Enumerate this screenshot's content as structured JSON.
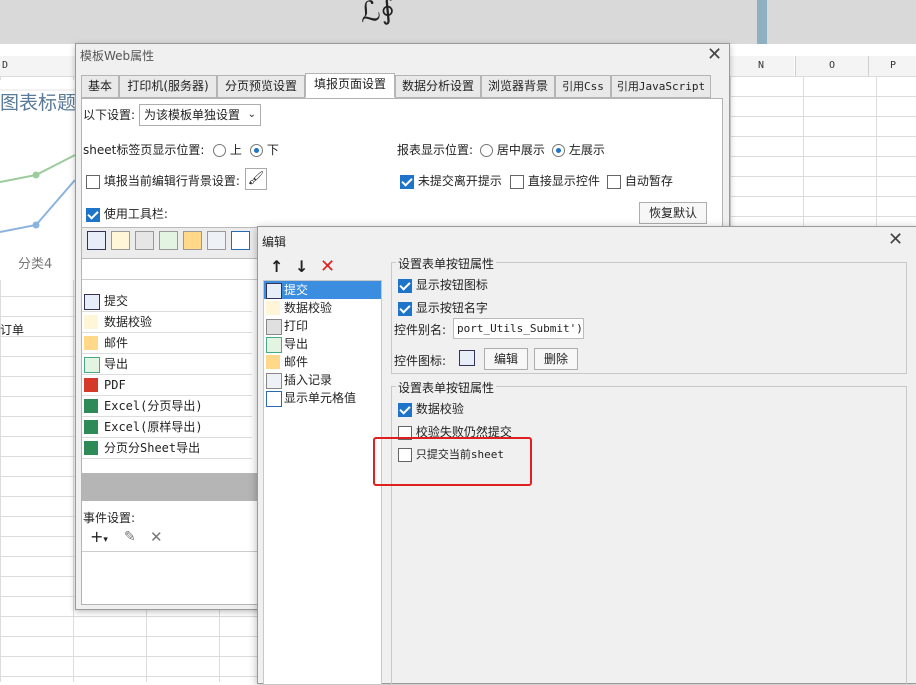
{
  "background": {
    "columns": [
      "D",
      "N",
      "O",
      "P"
    ],
    "chart_title": "图表标题",
    "chart_category": "分类4",
    "cell_text": "订单"
  },
  "dialog1": {
    "title": "模板Web属性",
    "tabs": [
      "基本",
      "打印机(服务器)",
      "分页预览设置",
      "填报页面设置",
      "数据分析设置",
      "浏览器背景",
      "引用Css",
      "引用JavaScript"
    ],
    "active_tab": "填报页面设置",
    "setting_label": "以下设置:",
    "setting_value": "为该模板单独设置",
    "sheet_position_label": "sheet标签页显示位置:",
    "sheet_pos_top": "上",
    "sheet_pos_bottom": "下",
    "report_position_label": "报表显示位置:",
    "report_pos_center": "居中展示",
    "report_pos_left": "左展示",
    "row_bg_label": "填报当前编辑行背景设置:",
    "unsubmitted_tip": "未提交离开提示",
    "direct_show_control": "直接显示控件",
    "auto_save": "自动暂存",
    "use_toolbar": "使用工具栏:",
    "restore_default": "恢复默认",
    "button_list": [
      "提交",
      "数据校验",
      "邮件",
      "导出",
      "PDF",
      "Excel(分页导出)",
      "Excel(原样导出)",
      "分页分Sheet导出"
    ],
    "event_settings": "事件设置:"
  },
  "dialog2": {
    "title": "编辑",
    "list_items": [
      "提交",
      "数据校验",
      "打印",
      "导出",
      "邮件",
      "插入记录",
      "显示单元格值"
    ],
    "group1_title": "设置表单按钮属性",
    "show_icon": "显示按钮图标",
    "show_name": "显示按钮名字",
    "alias_label": "控件别名:",
    "alias_value": "port_Utils_Submit')}",
    "icon_label": "控件图标:",
    "edit_button": "编辑",
    "delete_button": "删除",
    "group2_title": "设置表单按钮属性",
    "data_validation": "数据校验",
    "submit_on_fail": "校验失败仍然提交",
    "submit_current_sheet": "只提交当前sheet"
  },
  "colors": {
    "accent": "#1e74c8",
    "highlight": "#e02020",
    "selected": "#3b8de0"
  }
}
